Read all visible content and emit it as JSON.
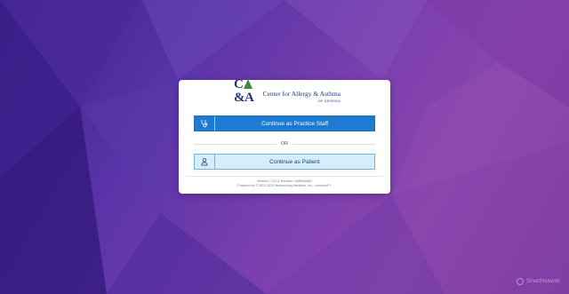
{
  "logo": {
    "mark_left": "C",
    "mark_right": "&A",
    "name": "Center for Allergy & Asthma",
    "sub": "OF GEORGIA"
  },
  "staff_button": {
    "label": "Continue as Practice Staff",
    "icon": "stethoscope-icon"
  },
  "divider": {
    "label": "OR"
  },
  "patient_button": {
    "label": "Continue as Patient",
    "icon": "person-icon"
  },
  "footer": {
    "version": "Version: 7.12.11 Revision: b58845c851",
    "powered": "Powered by © 2010-2020 Modernizing Medicine, Inc. • modmed™"
  },
  "watermark": {
    "text": "SmartNetwork"
  },
  "colors": {
    "primary": "#1e7bd2",
    "patient_bg": "#d6eefb",
    "logo_blue": "#1b3a7a",
    "logo_green": "#3c8a3a"
  }
}
